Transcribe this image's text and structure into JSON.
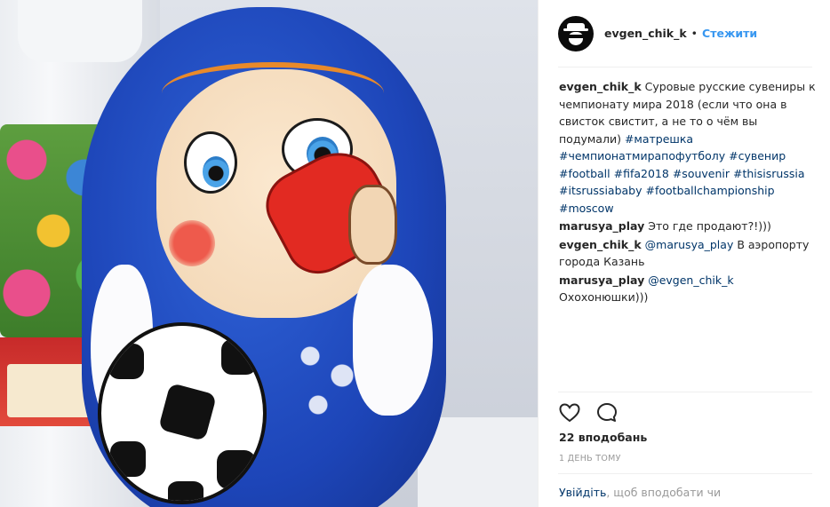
{
  "header": {
    "username": "evgen_chik_k",
    "separator": "•",
    "follow_label": "Стежити"
  },
  "caption": {
    "user": "evgen_chik_k",
    "text": "Суровые русские сувениры к чемпионату мира 2018 (если что она в свисток свистит, а не то о чём вы подумали)",
    "hashtags": [
      "#матрешка",
      "#чемпионатмирапофутболу",
      "#сувенир",
      "#football",
      "#fifa2018",
      "#souvenir",
      "#thisisrussia",
      "#itsrussiababy",
      "#footballchampionship",
      "#moscow"
    ]
  },
  "comments": [
    {
      "user": "marusya_play",
      "mention": "",
      "text": "Это где продают?!)))"
    },
    {
      "user": "evgen_chik_k",
      "mention": "@marusya_play",
      "text": "В аэропорту города Казань"
    },
    {
      "user": "marusya_play",
      "mention": "@evgen_chik_k",
      "text": "Охохонюшки)))"
    }
  ],
  "actions": {
    "like_icon": "heart-icon",
    "comment_icon": "comment-icon"
  },
  "likes": "22 вподобань",
  "time": "1 ДЕНЬ ТОМУ",
  "login_prompt": {
    "link": "Увійдіть",
    "text": ", щоб вподобати чи"
  }
}
